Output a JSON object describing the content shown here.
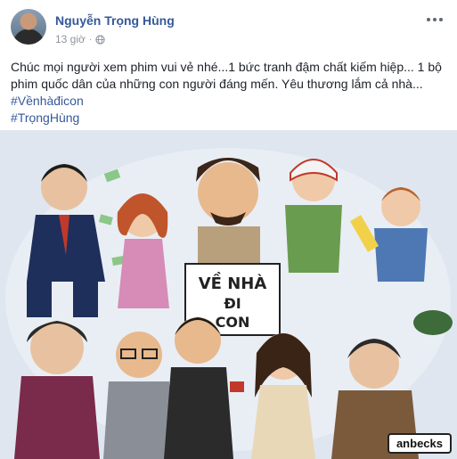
{
  "post": {
    "author": "Nguyễn Trọng Hùng",
    "time": "13 giờ",
    "separator": "·",
    "privacy_icon": "globe-icon",
    "more_icon": "more-horizontal-icon",
    "text_line1": "Chúc mọi người xem phim vui vẻ nhé...1 bức tranh đậm chất kiếm hiệp... 1 bộ",
    "text_line2": "phim quốc dân của những con người đáng mến. Yêu thương lắm cả nhà...",
    "hashtags": [
      "#Vềnhàđicon",
      "#TrọngHùng"
    ]
  },
  "image": {
    "sign_line1": "VỀ NHÀ",
    "sign_line2": "ĐI",
    "sign_line3": "CON",
    "signature": "anbecks"
  },
  "colors": {
    "link": "#365899",
    "meta": "#90949c",
    "text": "#1d2129",
    "image_bg": "#dfe6ef"
  }
}
